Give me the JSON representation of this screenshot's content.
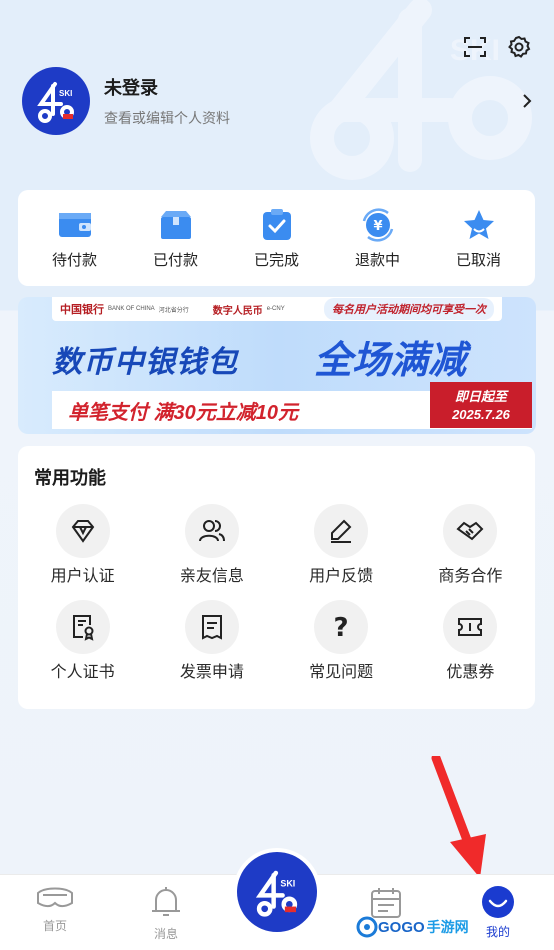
{
  "header": {
    "scan_icon": "scan-icon",
    "settings_icon": "gear-icon"
  },
  "profile": {
    "name": "未登录",
    "subtitle": "查看或编辑个人资料",
    "avatar_logo_text": "SKI"
  },
  "orders": [
    {
      "label": "待付款",
      "icon": "wallet-icon",
      "color": "#3b8cf0"
    },
    {
      "label": "已付款",
      "icon": "box-icon",
      "color": "#3b8cf0"
    },
    {
      "label": "已完成",
      "icon": "clipboard-check-icon",
      "color": "#3b8cf0"
    },
    {
      "label": "退款中",
      "icon": "refund-yen-icon",
      "color": "#3b8cf0"
    },
    {
      "label": "已取消",
      "icon": "star-icon",
      "color": "#3b8cf0"
    }
  ],
  "banner": {
    "bank": "中国银行",
    "bank_en": "BANK OF CHINA",
    "branch": "河北省分行",
    "branch_en": "HEBEI BRANCH",
    "ecny": "数字人民币",
    "ecny_en": "e-CNY",
    "promo": "每名用户活动期间均可享受一次",
    "title_a": "数币中银钱包",
    "title_b": "全场满减",
    "deal": "单笔支付 满30元立减10元",
    "date_label": "即日起至",
    "date_value": "2025.7.26"
  },
  "features": {
    "title": "常用功能",
    "items": [
      {
        "label": "用户认证",
        "icon": "diamond-icon"
      },
      {
        "label": "亲友信息",
        "icon": "users-icon"
      },
      {
        "label": "用户反馈",
        "icon": "edit-icon"
      },
      {
        "label": "商务合作",
        "icon": "handshake-icon"
      },
      {
        "label": "个人证书",
        "icon": "certificate-icon"
      },
      {
        "label": "发票申请",
        "icon": "receipt-icon"
      },
      {
        "label": "常见问题",
        "icon": "question-icon"
      },
      {
        "label": "优惠券",
        "icon": "ticket-icon"
      }
    ]
  },
  "tabbar": {
    "tabs": [
      {
        "label": "首页",
        "icon": "goggles-icon"
      },
      {
        "label": "消息",
        "icon": "bell-icon"
      },
      {
        "label": "",
        "icon": "calendar-icon"
      },
      {
        "label": "我的",
        "icon": "profile-smile-icon"
      }
    ],
    "active_color": "#1a3bcf"
  },
  "watermark": {
    "brand": "GOGO",
    "cn": "手游网",
    "url": "WWW.GOGO.CN"
  }
}
